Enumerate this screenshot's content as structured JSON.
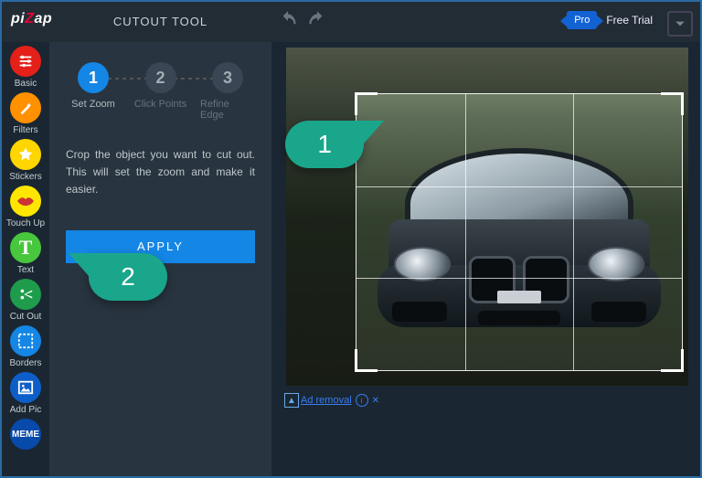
{
  "logo": {
    "pi": "pi",
    "z": "Z",
    "ap": "ap"
  },
  "panel_title": "CUTOUT TOOL",
  "pro_label": "Pro",
  "trial_label": "Free Trial",
  "sidebar": {
    "items": [
      {
        "label": "Basic"
      },
      {
        "label": "Filters"
      },
      {
        "label": "Stickers"
      },
      {
        "label": "Touch Up"
      },
      {
        "label": "Text"
      },
      {
        "label": "Cut Out"
      },
      {
        "label": "Borders"
      },
      {
        "label": "Add Pic"
      },
      {
        "label": "MEME"
      }
    ]
  },
  "steps": [
    {
      "num": "1",
      "label": "Set Zoom",
      "active": true
    },
    {
      "num": "2",
      "label": "Click Points",
      "active": false
    },
    {
      "num": "3",
      "label": "Refine Edge",
      "active": false
    }
  ],
  "description": "Crop the object you want to cut out. This will set the zoom and make it easier.",
  "apply_label": "APPLY",
  "ad_text": "Ad removal",
  "callouts": {
    "one": "1",
    "two": "2"
  }
}
